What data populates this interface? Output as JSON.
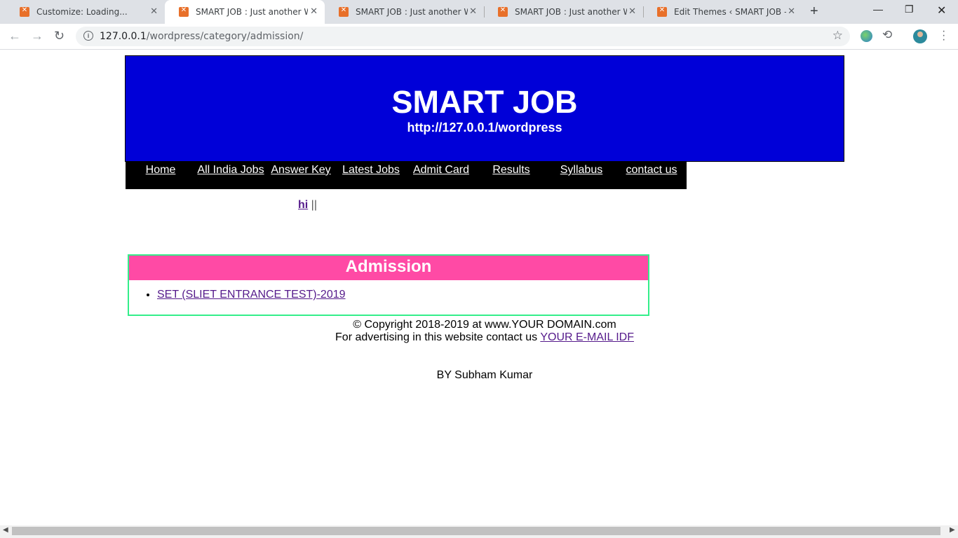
{
  "browser": {
    "tabs": [
      {
        "title": "Customize: Loading...",
        "active": false
      },
      {
        "title": "SMART JOB : Just another WordPress site",
        "active": true
      },
      {
        "title": "SMART JOB : Just another WordPress site",
        "active": false
      },
      {
        "title": "SMART JOB : Just another WordPress site",
        "active": false
      },
      {
        "title": "Edit Themes ‹ SMART JOB — WordPress",
        "active": false
      }
    ],
    "url_host": "127.0.0.1",
    "url_path": "/wordpress/category/admission/"
  },
  "header": {
    "title": "SMART JOB",
    "url": "http://127.0.0.1/wordpress"
  },
  "nav": {
    "items": [
      "Home",
      "All India Jobs",
      "Answer Key",
      "Latest Jobs",
      "Admit Card",
      "Results",
      "Syllabus",
      "contact us"
    ]
  },
  "hi_row": {
    "link": "hi",
    "sep": "||"
  },
  "category": {
    "heading": "Admission",
    "posts": [
      "SET (SLIET ENTRANCE TEST)-2019"
    ]
  },
  "footer": {
    "copyright": "© Copyright 2018-2019 at www.YOUR DOMAIN.com",
    "advert_text": "For advertising in this website contact us",
    "advert_link": "YOUR E-MAIL IDF",
    "by_line": "BY Subham Kumar"
  }
}
